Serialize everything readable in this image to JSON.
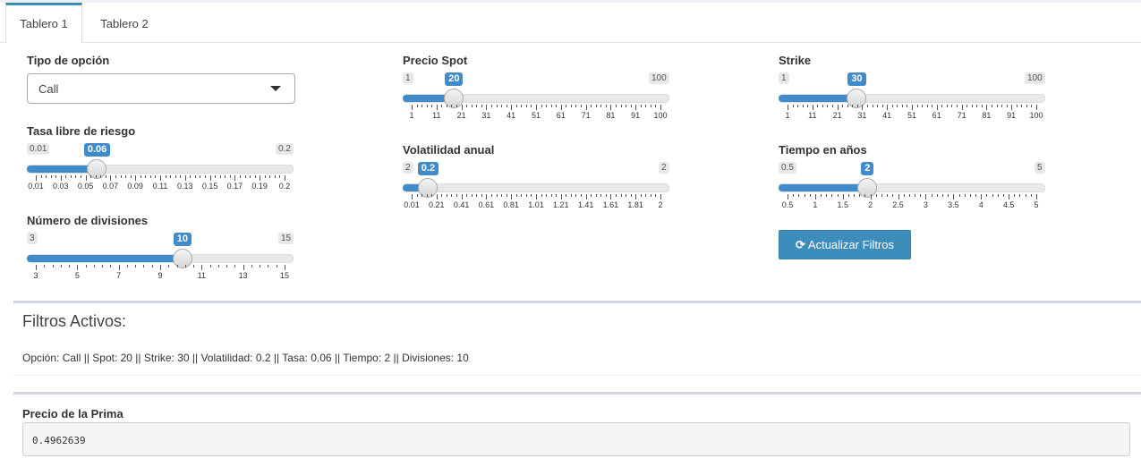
{
  "tabs": [
    {
      "label": "Tablero 1",
      "active": true
    },
    {
      "label": "Tablero 2",
      "active": false
    }
  ],
  "controls": {
    "tipo": {
      "label": "Tipo de opción",
      "value": "Call"
    },
    "tasa": {
      "label": "Tasa libre de riesgo",
      "min": "0.01",
      "max": "0.2",
      "value": "0.06",
      "fraction": 0.263,
      "ticks": [
        "0.01",
        "0.03",
        "0.05",
        "0.07",
        "0.09",
        "0.11",
        "0.13",
        "0.15",
        "0.17",
        "0.19",
        "0.2"
      ]
    },
    "divisiones": {
      "label": "Número de divisiones",
      "min": "3",
      "max": "15",
      "value": "10",
      "fraction": 0.583,
      "ticks": [
        "3",
        "5",
        "7",
        "9",
        "11",
        "13",
        "15"
      ]
    },
    "spot": {
      "label": "Precio Spot",
      "min": "1",
      "max": "100",
      "value": "20",
      "fraction": 0.192,
      "ticks": [
        "1",
        "11",
        "21",
        "31",
        "41",
        "51",
        "61",
        "71",
        "81",
        "91",
        "100"
      ]
    },
    "volatilidad": {
      "label": "Volatilidad anual",
      "min": "2",
      "max": "2",
      "value": "0.2",
      "fraction": 0.095,
      "ticks": [
        "0.01",
        "0.21",
        "0.41",
        "0.61",
        "0.81",
        "1.01",
        "1.21",
        "1.41",
        "1.61",
        "1.81",
        "2"
      ]
    },
    "strike": {
      "label": "Strike",
      "min": "1",
      "max": "100",
      "value": "30",
      "fraction": 0.293,
      "ticks": [
        "1",
        "11",
        "21",
        "31",
        "41",
        "51",
        "61",
        "71",
        "81",
        "91",
        "100"
      ]
    },
    "tiempo": {
      "label": "Tiempo en años",
      "min": "0.5",
      "max": "5",
      "value": "2",
      "fraction": 0.333,
      "ticks": [
        "0.5",
        "1",
        "1.5",
        "2",
        "2.5",
        "3",
        "3.5",
        "4",
        "4.5",
        "5"
      ]
    }
  },
  "update_button": {
    "label": "Actualizar Filtros",
    "icon": "refresh-icon"
  },
  "filters": {
    "title": "Filtros Activos:",
    "text": "Opción: Call || Spot: 20 || Strike: 30 || Volatilidad: 0.2 || Tasa: 0.06 || Tiempo: 2 || Divisiones: 10"
  },
  "result": {
    "label": "Precio de la Prima",
    "value": "0.4962639"
  },
  "colors": {
    "accent": "#428bca",
    "button": "#3c8dbc"
  }
}
